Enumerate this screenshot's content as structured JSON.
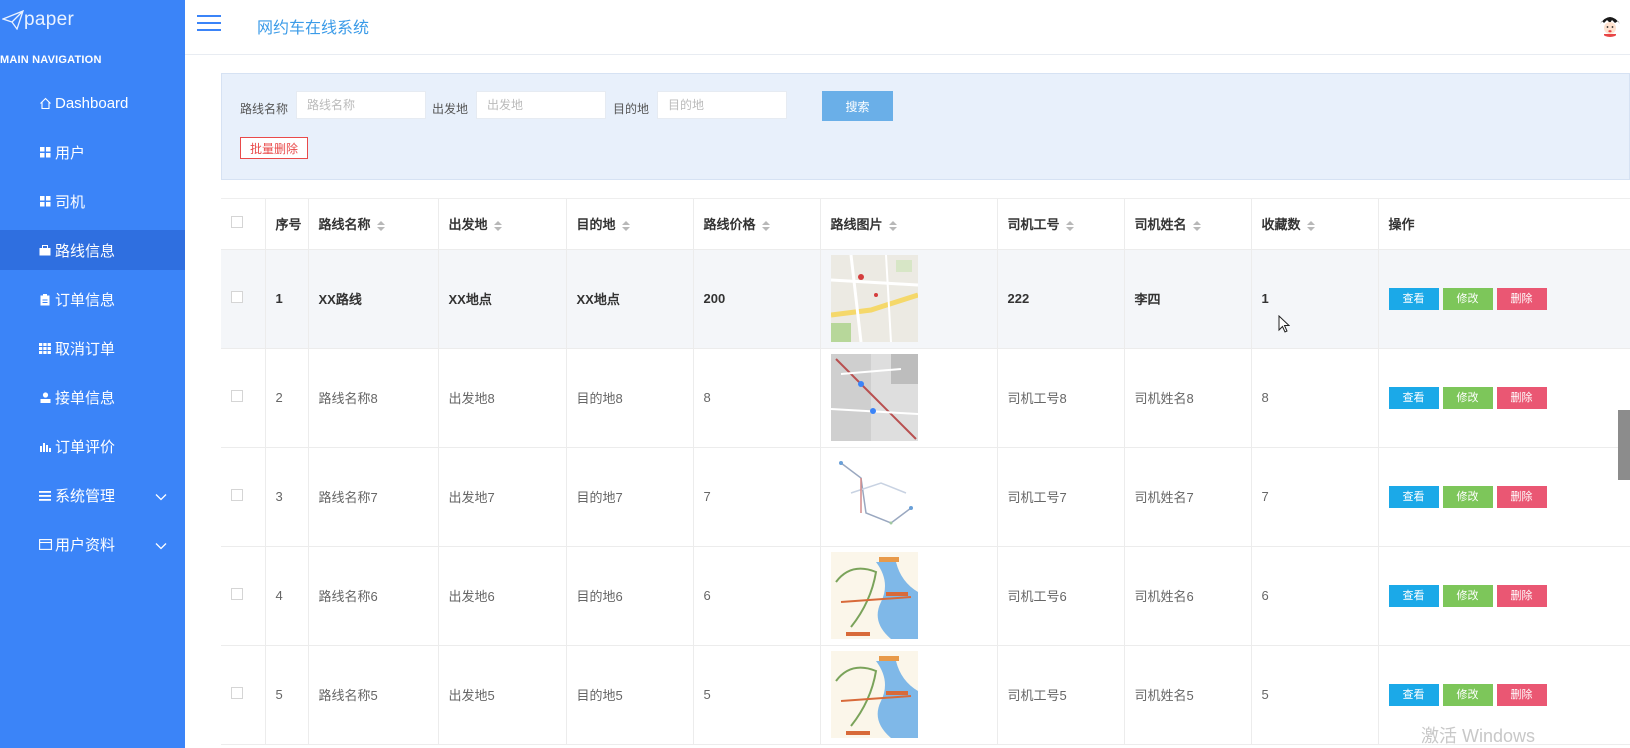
{
  "app": {
    "logo_text": "paper",
    "nav_title": "MAIN NAVIGATION",
    "system_title": "网约车在线系统"
  },
  "sidebar": {
    "items": [
      {
        "label": "Dashboard",
        "icon": "home-icon"
      },
      {
        "label": "用户",
        "icon": "grid-icon"
      },
      {
        "label": "司机",
        "icon": "grid-icon"
      },
      {
        "label": "路线信息",
        "icon": "briefcase-icon",
        "active": true
      },
      {
        "label": "订单信息",
        "icon": "clipboard-icon"
      },
      {
        "label": "取消订单",
        "icon": "table-icon"
      },
      {
        "label": "接单信息",
        "icon": "user-icon"
      },
      {
        "label": "订单评价",
        "icon": "bar-chart-icon"
      },
      {
        "label": "系统管理",
        "icon": "list-icon",
        "expandable": true
      },
      {
        "label": "用户资料",
        "icon": "card-icon",
        "expandable": true
      }
    ]
  },
  "search": {
    "route_name_label": "路线名称",
    "route_name_placeholder": "路线名称",
    "departure_label": "出发地",
    "departure_placeholder": "出发地",
    "destination_label": "目的地",
    "destination_placeholder": "目的地",
    "search_button": "搜索",
    "batch_delete_button": "批量删除"
  },
  "table": {
    "headers": {
      "index": "序号",
      "route_name": "路线名称",
      "departure": "出发地",
      "destination": "目的地",
      "price": "路线价格",
      "image": "路线图片",
      "driver_id": "司机工号",
      "driver_name": "司机姓名",
      "favorites": "收藏数",
      "actions": "操作"
    },
    "action_labels": {
      "view": "查看",
      "edit": "修改",
      "delete": "删除"
    },
    "rows": [
      {
        "index": "1",
        "route_name": "XX路线",
        "departure": "XX地点",
        "destination": "XX地点",
        "price": "200",
        "driver_id": "222",
        "driver_name": "李四",
        "favorites": "1"
      },
      {
        "index": "2",
        "route_name": "路线名称8",
        "departure": "出发地8",
        "destination": "目的地8",
        "price": "8",
        "driver_id": "司机工号8",
        "driver_name": "司机姓名8",
        "favorites": "8"
      },
      {
        "index": "3",
        "route_name": "路线名称7",
        "departure": "出发地7",
        "destination": "目的地7",
        "price": "7",
        "driver_id": "司机工号7",
        "driver_name": "司机姓名7",
        "favorites": "7"
      },
      {
        "index": "4",
        "route_name": "路线名称6",
        "departure": "出发地6",
        "destination": "目的地6",
        "price": "6",
        "driver_id": "司机工号6",
        "driver_name": "司机姓名6",
        "favorites": "6"
      },
      {
        "index": "5",
        "route_name": "路线名称5",
        "departure": "出发地5",
        "destination": "目的地5",
        "price": "5",
        "driver_id": "司机工号5",
        "driver_name": "司机姓名5",
        "favorites": "5"
      }
    ]
  },
  "watermark": "激活 Windows",
  "colors": {
    "sidebar": "#3b84f8",
    "sidebar_active": "#2f6fe0",
    "view_button": "#1ba9e8",
    "edit_button": "#7dc65a",
    "delete_button": "#ea5773",
    "search_button": "#6aafe8"
  }
}
